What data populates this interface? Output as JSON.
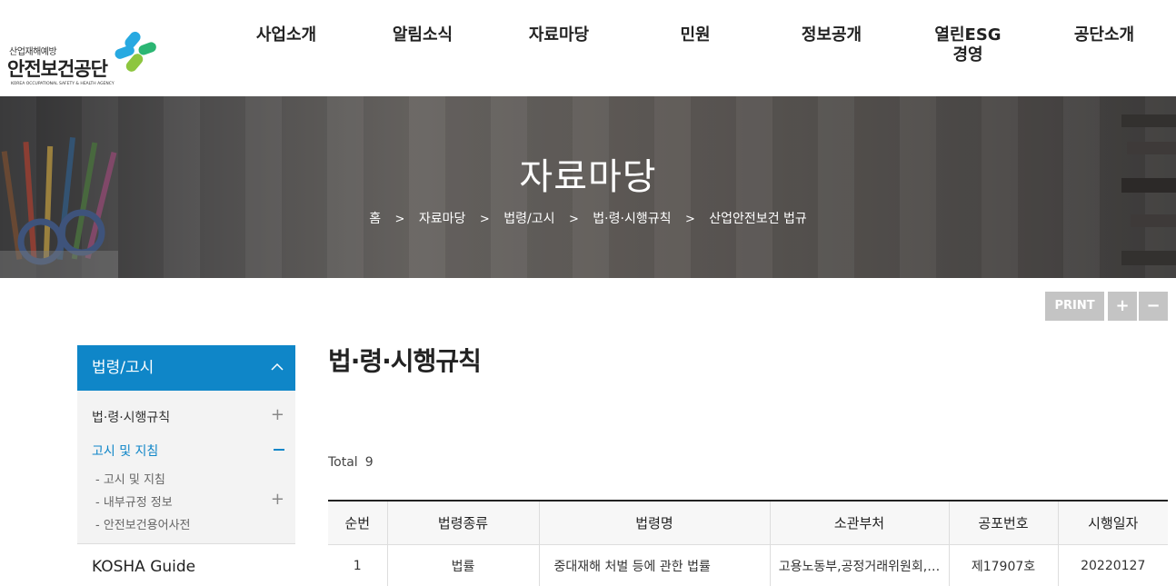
{
  "logo": {
    "sub": "산업재해예방",
    "main": "안전보건공단",
    "eng": "KOREA OCCUPATIONAL SAFETY & HEALTH AGENCY"
  },
  "gnb": [
    "사업소개",
    "알림소식",
    "자료마당",
    "민원",
    "정보공개",
    "열린ESG\n경영",
    "공단소개"
  ],
  "visual": {
    "title": "자료마당",
    "breadcrumb": [
      "홈",
      "자료마당",
      "법령/고시",
      "법·령·시행규칙",
      "산업안전보건 법규"
    ],
    "separator": ">"
  },
  "util": {
    "print": "PRINT",
    "zoom_in": "+",
    "zoom_out": "−"
  },
  "lnb": {
    "head": "법령/고시",
    "items": [
      {
        "label": "법·령·시행규칙",
        "toggle": "+"
      },
      {
        "label": "고시 및 지침"
      }
    ],
    "sub_items": [
      {
        "label": "- 고시 및 지침"
      },
      {
        "label": "- 내부규정 정보",
        "toggle": "+"
      },
      {
        "label": "- 안전보건용어사전"
      }
    ],
    "guide": "KOSHA Guide"
  },
  "content": {
    "title": "법·령·시행규칙",
    "total_label": "Total",
    "total_count": "9",
    "table": {
      "headers": [
        "순번",
        "법령종류",
        "법령명",
        "소관부처",
        "공포번호",
        "시행일자"
      ],
      "rows": [
        [
          "1",
          "법률",
          "중대재해 처벌 등에 관한 법률",
          "고용노동부,공정거래위원회,…",
          "제17907호",
          "20220127"
        ]
      ]
    }
  },
  "colors": {
    "accent": "#0f86c8",
    "util_button": "#c4c4c4"
  }
}
